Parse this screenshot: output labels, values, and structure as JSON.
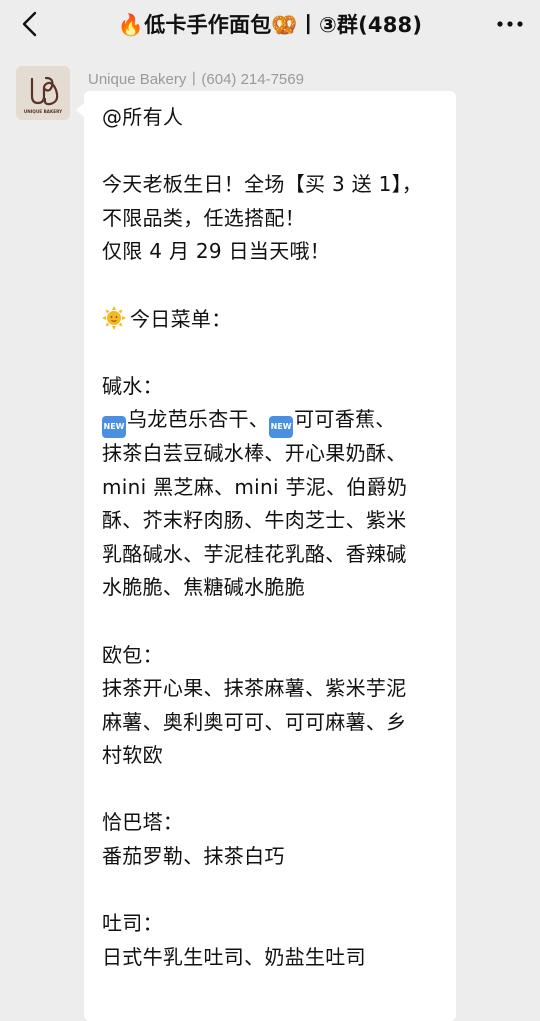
{
  "header": {
    "title": "🔥低卡手作面包🥨丨③群(488)",
    "back_icon": "chevron-left-icon",
    "more_icon": "more-dots-icon"
  },
  "message": {
    "avatar_text": "UNIQUE BAKERY",
    "sender": "Unique Bakery丨(604) 214-7569",
    "mention": "@所有人",
    "intro": [
      "今天老板生日！全场【买 3 送 1】，",
      "不限品类，任选搭配！",
      "仅限 4 月 29 日当天哦！"
    ],
    "badge_new": "NEW",
    "menu_title": "今日菜单：",
    "sections": {
      "jianshui": {
        "title": "碱水：",
        "line1_a": "乌龙芭乐杏干、",
        "line1_b": "可可香蕉、",
        "lines": [
          "抹茶白芸豆碱水棒、开心果奶酥、",
          "mini 黑芝麻、mini 芋泥、伯爵奶",
          "酥、芥末籽肉肠、牛肉芝士、紫米",
          "乳酪碱水、芋泥桂花乳酪、香辣碱",
          "水脆脆、焦糖碱水脆脆"
        ]
      },
      "oubao": {
        "title": "欧包：",
        "lines": [
          "抹茶开心果、抹茶麻薯、紫米芋泥",
          "麻薯、奥利奥可可、可可麻薯、乡",
          "村软欧"
        ]
      },
      "qiabata": {
        "title": "恰巴塔：",
        "lines": [
          "番茄罗勒、抹茶白巧"
        ]
      },
      "tusi": {
        "title": "吐司：",
        "lines": [
          "日式牛乳生吐司、奶盐生吐司"
        ]
      }
    }
  },
  "colors": {
    "background": "#ededed",
    "bubble": "#ffffff",
    "sender_text": "#9a9a9a",
    "badge_blue": "#4a8fe0"
  }
}
